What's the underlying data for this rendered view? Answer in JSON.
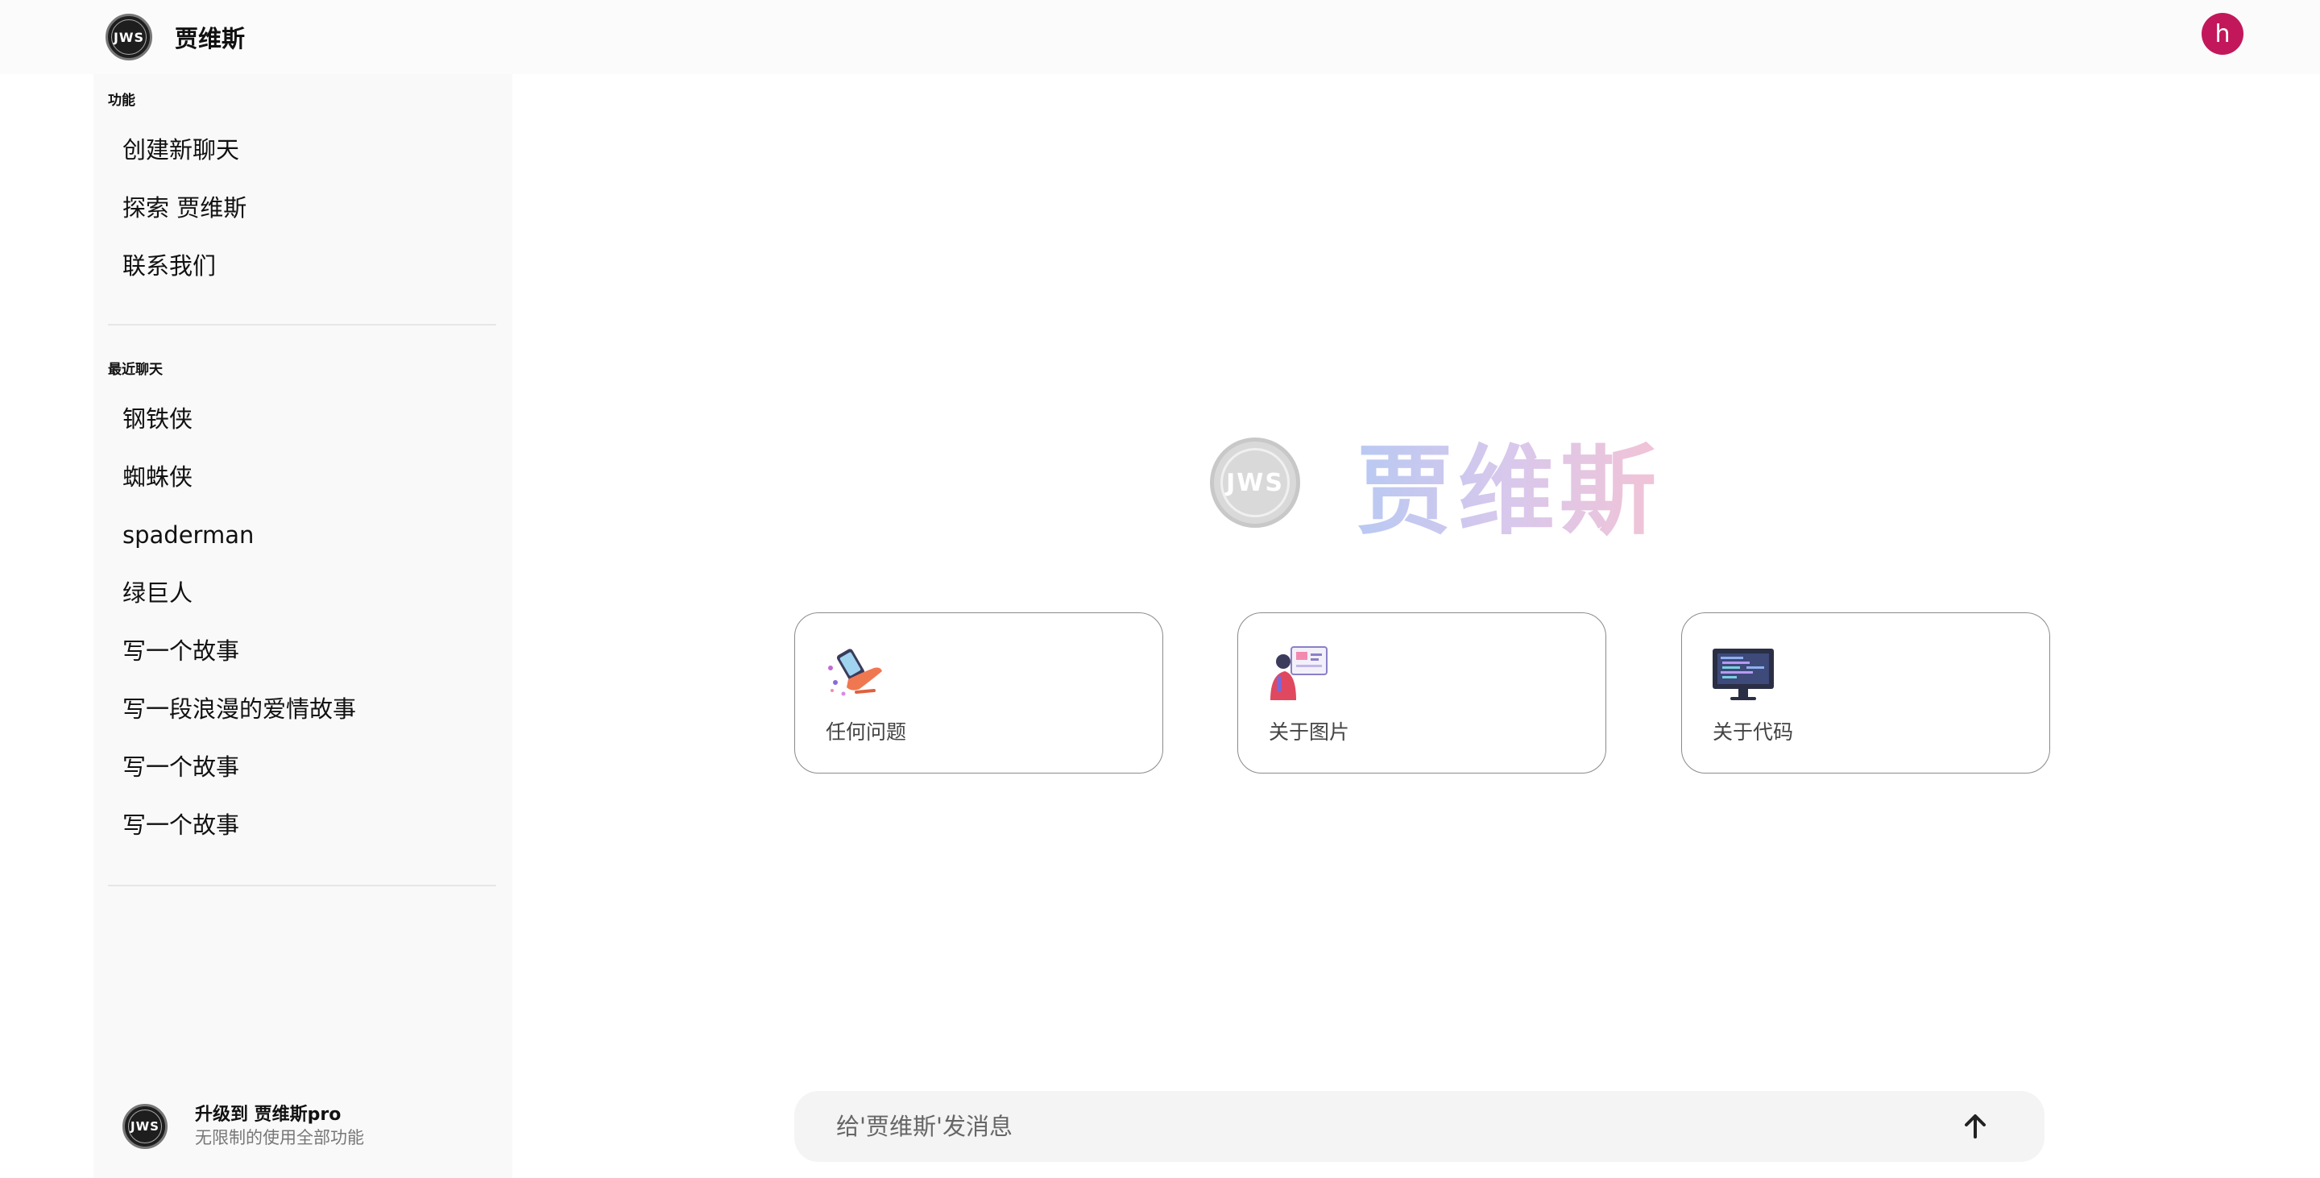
{
  "header": {
    "logo_text": "JWS",
    "brand_name": "贾维斯",
    "avatar_letter": "h",
    "avatar_color": "#c2185b"
  },
  "sidebar": {
    "functions_title": "功能",
    "functions": [
      {
        "label": "创建新聊天"
      },
      {
        "label": "探索 贾维斯"
      },
      {
        "label": "联系我们"
      }
    ],
    "recent_title": "最近聊天",
    "recent": [
      {
        "label": "钢铁侠"
      },
      {
        "label": "蜘蛛侠"
      },
      {
        "label": "spaderman"
      },
      {
        "label": "绿巨人"
      },
      {
        "label": "写一个故事"
      },
      {
        "label": "写一段浪漫的爱情故事"
      },
      {
        "label": "写一个故事"
      },
      {
        "label": "写一个故事"
      }
    ],
    "upgrade": {
      "logo_text": "JWS",
      "title": "升级到 贾维斯pro",
      "subtitle": "无限制的使用全部功能"
    }
  },
  "hero": {
    "logo_text": "JWS",
    "title": "贾维斯"
  },
  "cards": [
    {
      "label": "任何问题",
      "icon": "phone-hand-icon"
    },
    {
      "label": "关于图片",
      "icon": "image-person-icon"
    },
    {
      "label": "关于代码",
      "icon": "code-monitor-icon"
    }
  ],
  "composer": {
    "placeholder": "给'贾维斯'发消息",
    "send_icon": "arrow-up-icon"
  }
}
